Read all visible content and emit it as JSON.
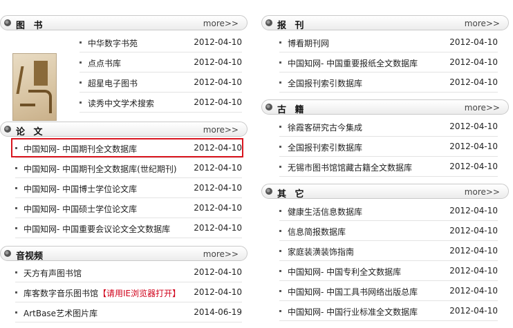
{
  "left": {
    "books": {
      "title": "图 书",
      "more": "more>>",
      "rows": [
        {
          "title": "中华数字书苑",
          "date": "2012-04-10"
        },
        {
          "title": "点点书库",
          "date": "2012-04-10"
        },
        {
          "title": "超星电子图书",
          "date": "2012-04-10"
        },
        {
          "title": "读秀中文学术搜索",
          "date": "2012-04-10"
        }
      ]
    },
    "papers": {
      "title": "论 文",
      "more": "more>>",
      "rows": [
        {
          "title": "中国知网- 中国期刊全文数据库",
          "date": "2012-04-10"
        },
        {
          "title": "中国知网- 中国期刊全文数据库(世纪期刊)",
          "date": "2012-04-10"
        },
        {
          "title": "中国知网- 中国博士学位论文库",
          "date": "2012-04-10"
        },
        {
          "title": "中国知网- 中国硕士学位论文库",
          "date": "2012-04-10"
        },
        {
          "title": "中国知网- 中国重要会议论文全文数据库",
          "date": "2012-04-10"
        }
      ]
    },
    "av": {
      "title": "音视频",
      "more": "more>>",
      "rows": [
        {
          "title": "天方有声图书馆",
          "date": "2012-04-10"
        },
        {
          "title": "库客数字音乐图书馆",
          "title_warn": "【请用IE浏览器打开】",
          "date": "2012-04-10"
        },
        {
          "title": "ArtBase艺术图片库",
          "date": "2014-06-19"
        }
      ]
    }
  },
  "right": {
    "newspapers": {
      "title": "报 刊",
      "more": "more>>",
      "rows": [
        {
          "title": "博看期刊网",
          "date": "2012-04-10"
        },
        {
          "title": "中国知网- 中国重要报纸全文数据库",
          "date": "2012-04-10"
        },
        {
          "title": "全国报刊索引数据库",
          "date": "2012-04-10"
        }
      ]
    },
    "ancient": {
      "title": "古 籍",
      "more": "more>>",
      "rows": [
        {
          "title": "徐霞客研究古今集成",
          "date": "2012-04-10"
        },
        {
          "title": "全国报刊索引数据库",
          "date": "2012-04-10"
        },
        {
          "title": "无锡市图书馆馆藏古籍全文数据库",
          "date": "2012-04-10"
        }
      ]
    },
    "other": {
      "title": "其 它",
      "more": "more>>",
      "rows": [
        {
          "title": "健康生活信息数据库",
          "date": "2012-04-10"
        },
        {
          "title": "信息简报数据库",
          "date": "2012-04-10"
        },
        {
          "title": "家庭装潢装饰指南",
          "date": "2012-04-10"
        },
        {
          "title": "中国知网- 中国专利全文数据库",
          "date": "2012-04-10"
        },
        {
          "title": "中国知网- 中国工具书网络出版总库",
          "date": "2012-04-10"
        },
        {
          "title": "中国知网- 中国行业标准全文数据库",
          "date": "2012-04-10"
        }
      ]
    }
  }
}
